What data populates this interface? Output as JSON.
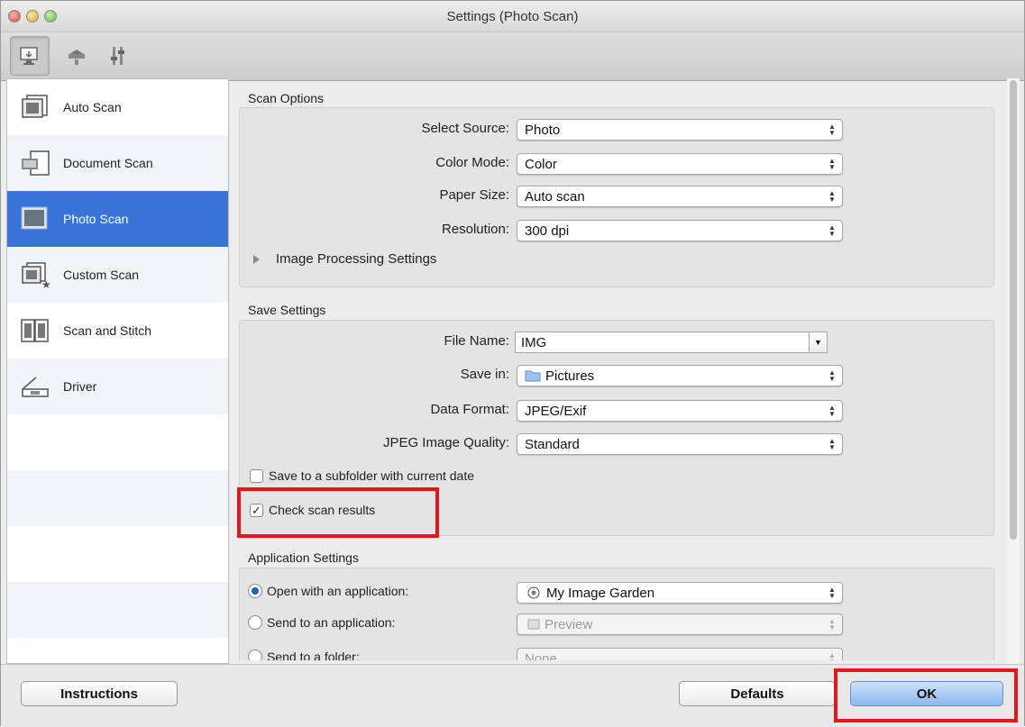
{
  "window": {
    "title": "Settings (Photo Scan)"
  },
  "toolbar": {
    "items": [
      {
        "icon": "scan-from-computer-icon",
        "selected": true
      },
      {
        "icon": "scan-from-operation-panel-icon",
        "selected": false
      },
      {
        "icon": "general-settings-icon",
        "selected": false
      }
    ]
  },
  "sidebar": {
    "items": [
      {
        "label": "Auto Scan",
        "icon": "auto-scan-icon"
      },
      {
        "label": "Document Scan",
        "icon": "document-scan-icon"
      },
      {
        "label": "Photo Scan",
        "icon": "photo-scan-icon",
        "selected": true
      },
      {
        "label": "Custom Scan",
        "icon": "custom-scan-icon"
      },
      {
        "label": "Scan and Stitch",
        "icon": "scan-and-stitch-icon"
      },
      {
        "label": "Driver",
        "icon": "driver-icon"
      }
    ]
  },
  "scan_options": {
    "title": "Scan Options",
    "select_source": {
      "label": "Select Source:",
      "value": "Photo"
    },
    "color_mode": {
      "label": "Color Mode:",
      "value": "Color"
    },
    "paper_size": {
      "label": "Paper Size:",
      "value": "Auto scan"
    },
    "resolution": {
      "label": "Resolution:",
      "value": "300 dpi"
    },
    "image_processing": {
      "label": "Image Processing Settings"
    }
  },
  "save_settings": {
    "title": "Save Settings",
    "file_name": {
      "label": "File Name:",
      "value": "IMG"
    },
    "save_in": {
      "label": "Save in:",
      "value": "Pictures"
    },
    "data_format": {
      "label": "Data Format:",
      "value": "JPEG/Exif"
    },
    "jpeg_quality": {
      "label": "JPEG Image Quality:",
      "value": "Standard"
    },
    "subfolder": {
      "label": "Save to a subfolder with current date",
      "checked": false
    },
    "check_results": {
      "label": "Check scan results",
      "checked": true
    }
  },
  "application_settings": {
    "title": "Application Settings",
    "open_with": {
      "label": "Open with an application:",
      "value": "My Image Garden",
      "selected": true
    },
    "send_to_app": {
      "label": "Send to an application:",
      "value": "Preview",
      "selected": false
    },
    "send_to_folder": {
      "label": "Send to a folder:",
      "value": "None",
      "selected": false
    }
  },
  "footer": {
    "instructions_label": "Instructions",
    "defaults_label": "Defaults",
    "ok_label": "OK"
  },
  "colors": {
    "selection": "#3874d8",
    "highlight": "#e4161c"
  }
}
